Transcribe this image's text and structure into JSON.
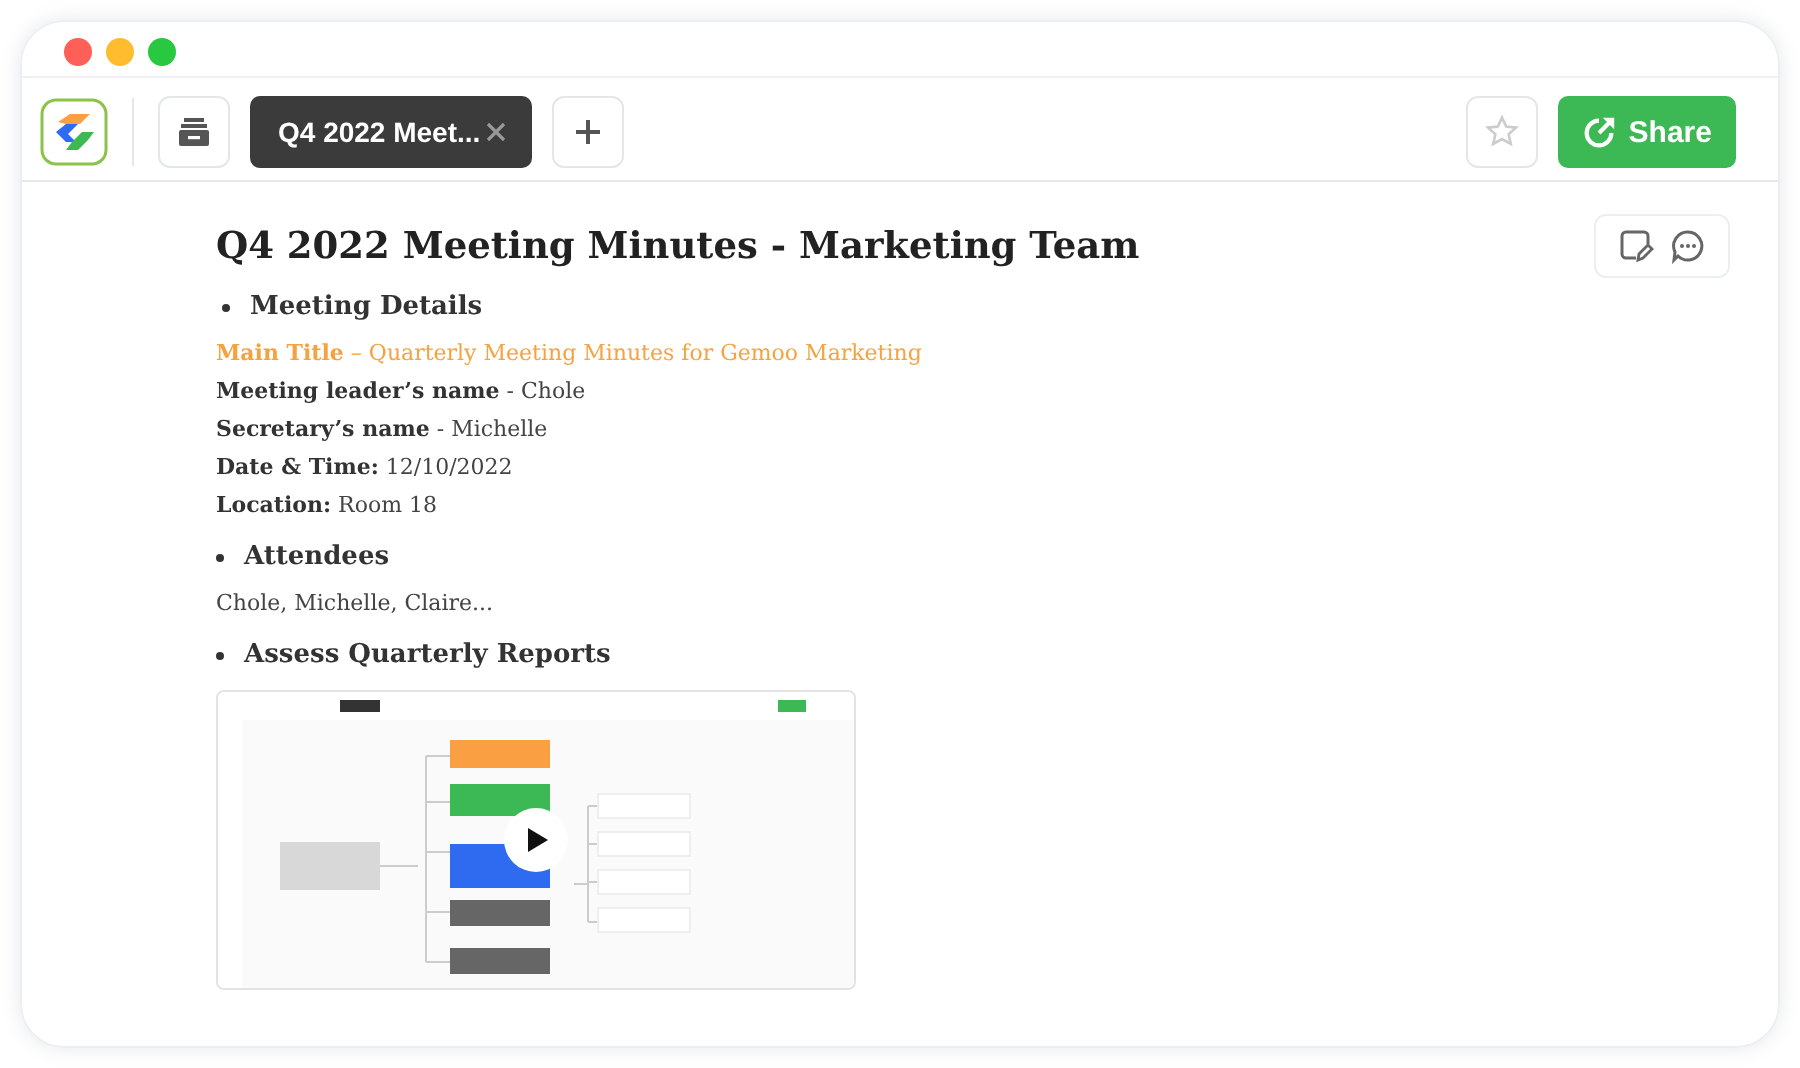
{
  "tabs": [
    {
      "label": "Q4 2022 Meet...",
      "selected": true
    }
  ],
  "share_button": {
    "label": "Share"
  },
  "document": {
    "title": "Q4 2022 Meeting Minutes - Marketing Team",
    "sections": [
      {
        "heading": "Meeting Details",
        "lines": [
          {
            "kind": "highlight",
            "text": "**Main Title** – Quarterly Meeting Minutes for Gemoo Marketing"
          },
          {
            "kind": "plain",
            "text": "**Meeting leader’s name** - Chole"
          },
          {
            "kind": "plain",
            "text": "**Secretary’s name** - Michelle"
          },
          {
            "kind": "plain",
            "text": "**Date & Time:** 12/10/2022"
          },
          {
            "kind": "plain",
            "text": "**Location:** Room 18"
          }
        ]
      },
      {
        "heading": "Attendees",
        "lines": [
          {
            "kind": "plain",
            "text": "Chole, Michelle, Claire..."
          }
        ]
      },
      {
        "heading": "Assess Quarterly Reports",
        "media": {
          "kind": "video"
        }
      }
    ]
  }
}
